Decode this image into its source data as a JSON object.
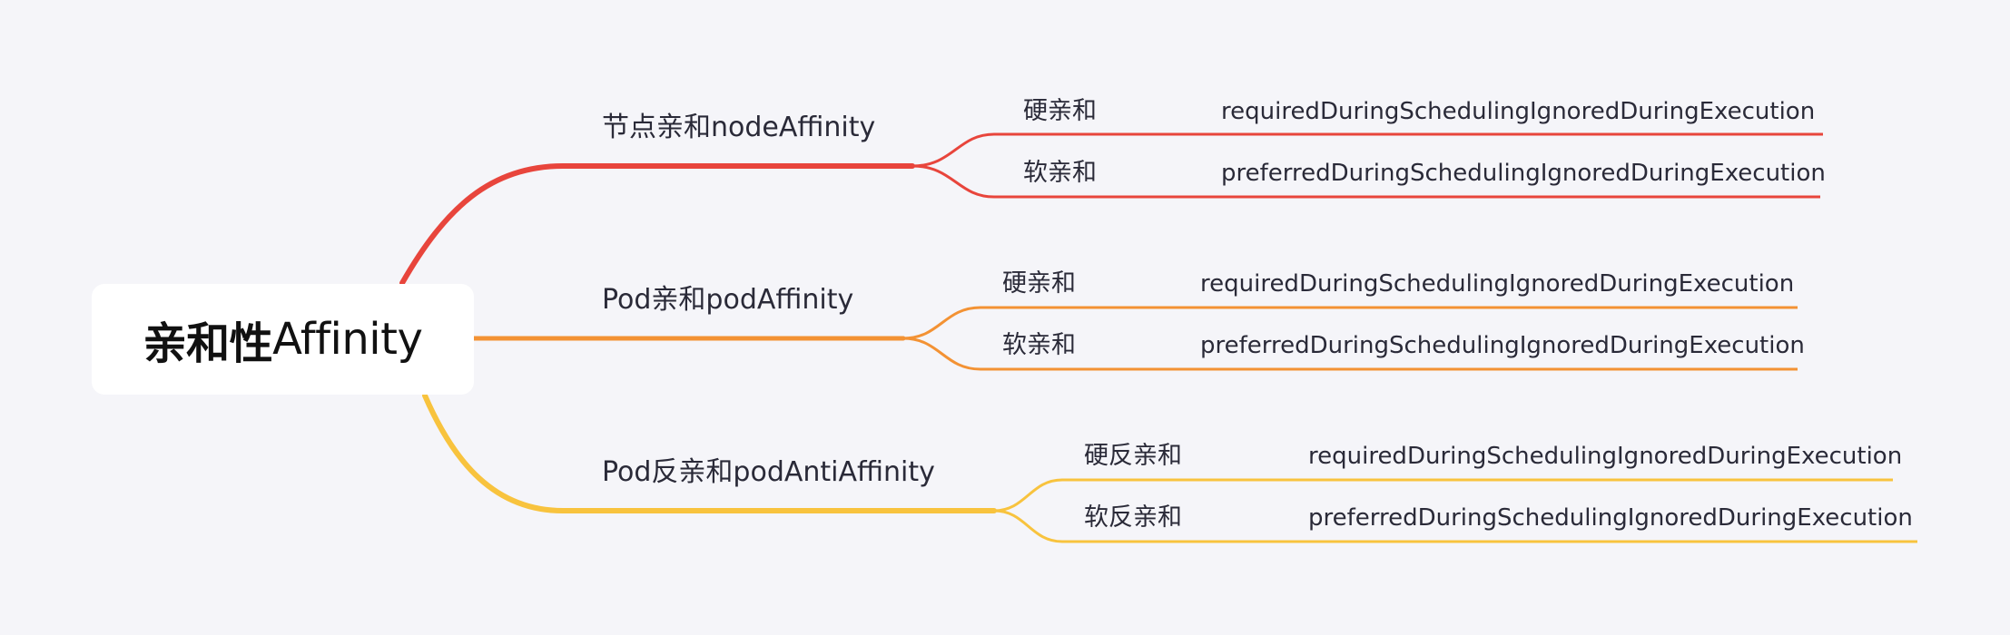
{
  "root": {
    "label_zh": "亲和性",
    "label_en": "Affinity"
  },
  "branches": [
    {
      "label": "节点亲和nodeAffinity",
      "color": "#e8453c",
      "children": [
        {
          "label": "硬亲和",
          "value": "requiredDuringSchedulingIgnoredDuringExecution"
        },
        {
          "label": "软亲和",
          "value": "preferredDuringSchedulingIgnoredDuringExecution"
        }
      ]
    },
    {
      "label": "Pod亲和podAffinity",
      "color": "#f39234",
      "children": [
        {
          "label": "硬亲和",
          "value": "requiredDuringSchedulingIgnoredDuringExecution"
        },
        {
          "label": "软亲和",
          "value": "preferredDuringSchedulingIgnoredDuringExecution"
        }
      ]
    },
    {
      "label": "Pod反亲和podAntiAffinity",
      "color": "#f8c33e",
      "children": [
        {
          "label": "硬反亲和",
          "value": "requiredDuringSchedulingIgnoredDuringExecution"
        },
        {
          "label": "软反亲和",
          "value": "preferredDuringSchedulingIgnoredDuringExecution"
        }
      ]
    }
  ]
}
